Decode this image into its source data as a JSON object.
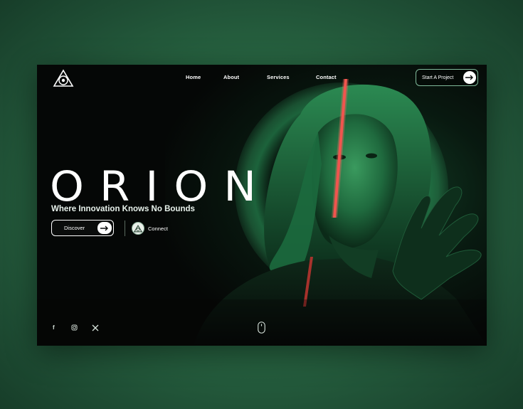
{
  "brand": {
    "logo": "triangle-emblem-icon"
  },
  "nav": {
    "links": [
      "Home",
      "About",
      "Services",
      "Contact"
    ],
    "cta_label": "Start A Project",
    "cta_icon": "arrow-right-icon"
  },
  "hero": {
    "title": "ORION",
    "subtitle": "Where Innovation Knows No Bounds",
    "discover_label": "Discover",
    "connect_label": "Connect",
    "connect_icon": "triangle-emblem-icon"
  },
  "social": {
    "facebook": "f",
    "instagram": "instagram-icon",
    "x": "x-icon"
  },
  "scroll_indicator": "mouse-icon",
  "colors": {
    "background": "#2a6b45",
    "frame": "#050706",
    "glow": "#3fc17a",
    "accent_line": "#e0453f",
    "text": "#ffffff"
  }
}
